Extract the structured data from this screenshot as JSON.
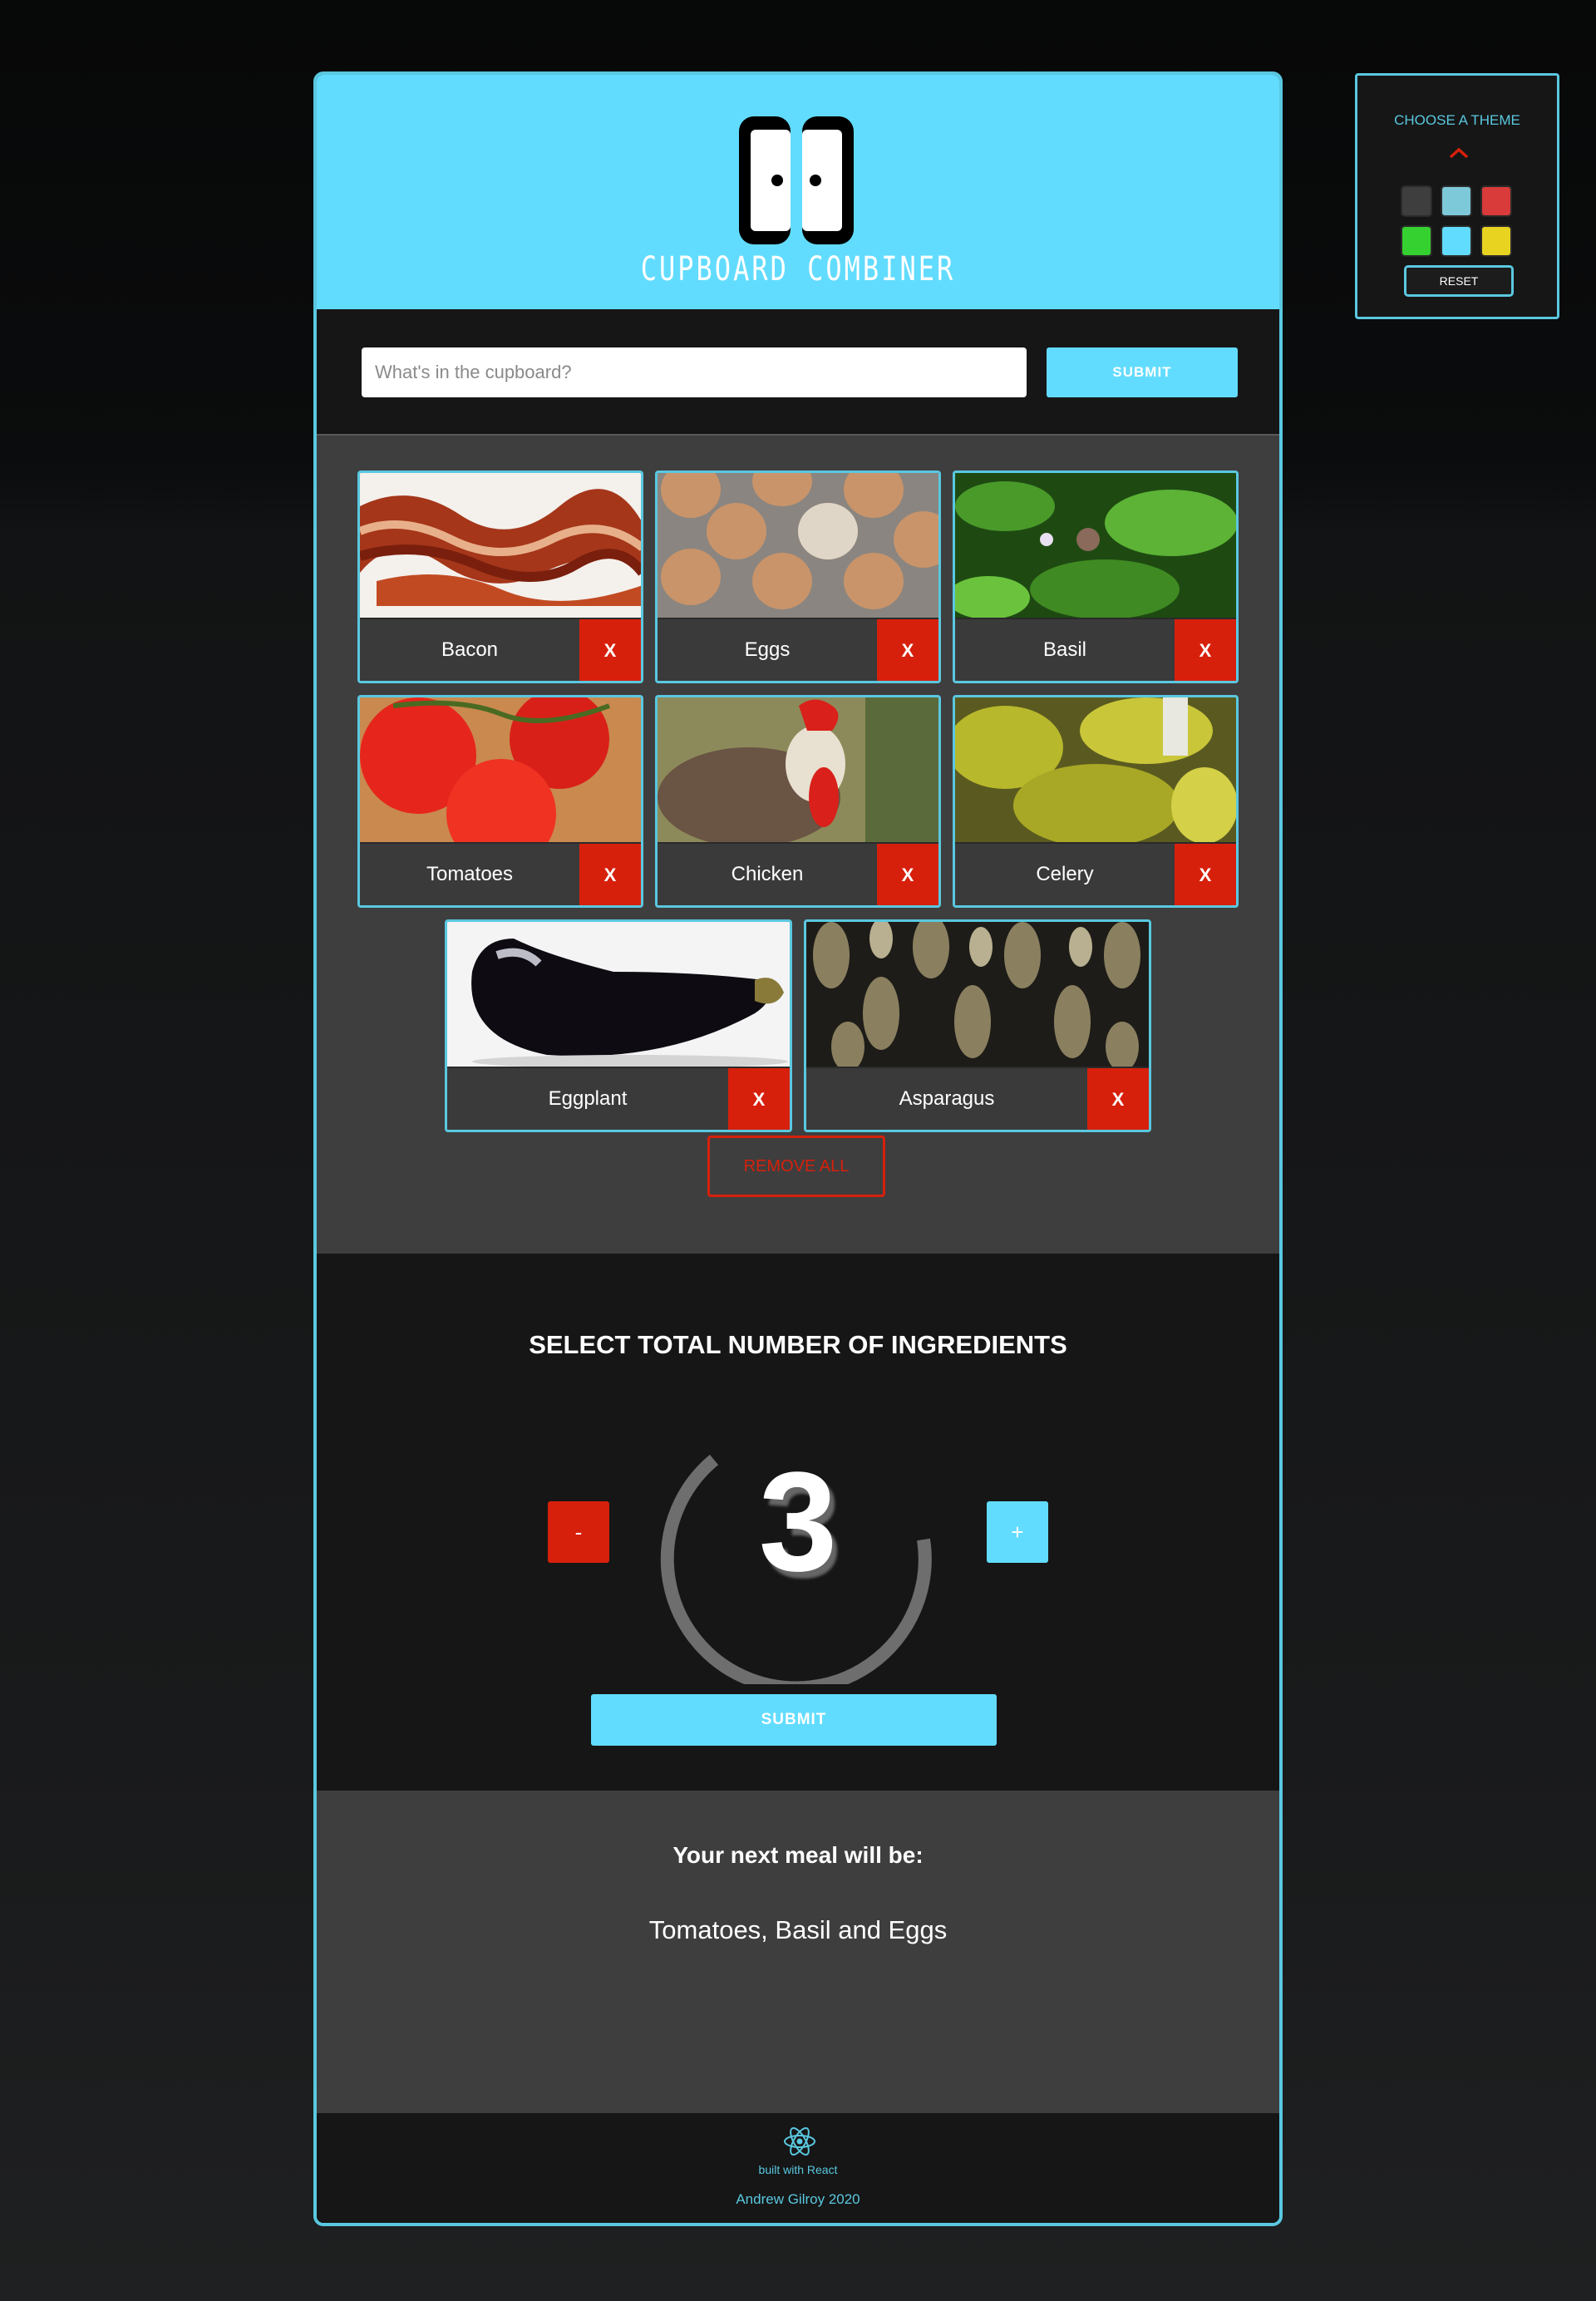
{
  "app": {
    "logo_text": "CUPBOARD COMBINER",
    "search": {
      "placeholder": "What's in the cupboard?",
      "submit_label": "SUBMIT"
    },
    "ingredients": [
      {
        "label": "Bacon",
        "remove_label": "X"
      },
      {
        "label": "Eggs",
        "remove_label": "X"
      },
      {
        "label": "Basil",
        "remove_label": "X"
      },
      {
        "label": "Tomatoes",
        "remove_label": "X"
      },
      {
        "label": "Chicken",
        "remove_label": "X"
      },
      {
        "label": "Celery",
        "remove_label": "X"
      },
      {
        "label": "Eggplant",
        "remove_label": "X"
      },
      {
        "label": "Asparagus",
        "remove_label": "X"
      }
    ],
    "remove_all_label": "REMOVE ALL",
    "selector": {
      "title": "SELECT TOTAL NUMBER OF INGREDIENTS",
      "minus_label": "-",
      "plus_label": "+",
      "count": "3",
      "submit_label": "SUBMIT"
    },
    "result": {
      "heading": "Your next meal will be:",
      "meal": "Tomatoes, Basil and Eggs"
    },
    "footer": {
      "built_with": "built with React",
      "author": "Andrew Gilroy 2020"
    }
  },
  "theme_panel": {
    "title": "CHOOSE A THEME",
    "reset_label": "RESET",
    "swatches": [
      "#3e3e3e",
      "#7ec9d9",
      "#d93a3a",
      "#35d131",
      "#62dcfe",
      "#e8d320"
    ]
  },
  "colors": {
    "accent": "#62dcfe",
    "danger": "#d7200c",
    "panel": "#3e3e3e",
    "dark": "#161616"
  }
}
